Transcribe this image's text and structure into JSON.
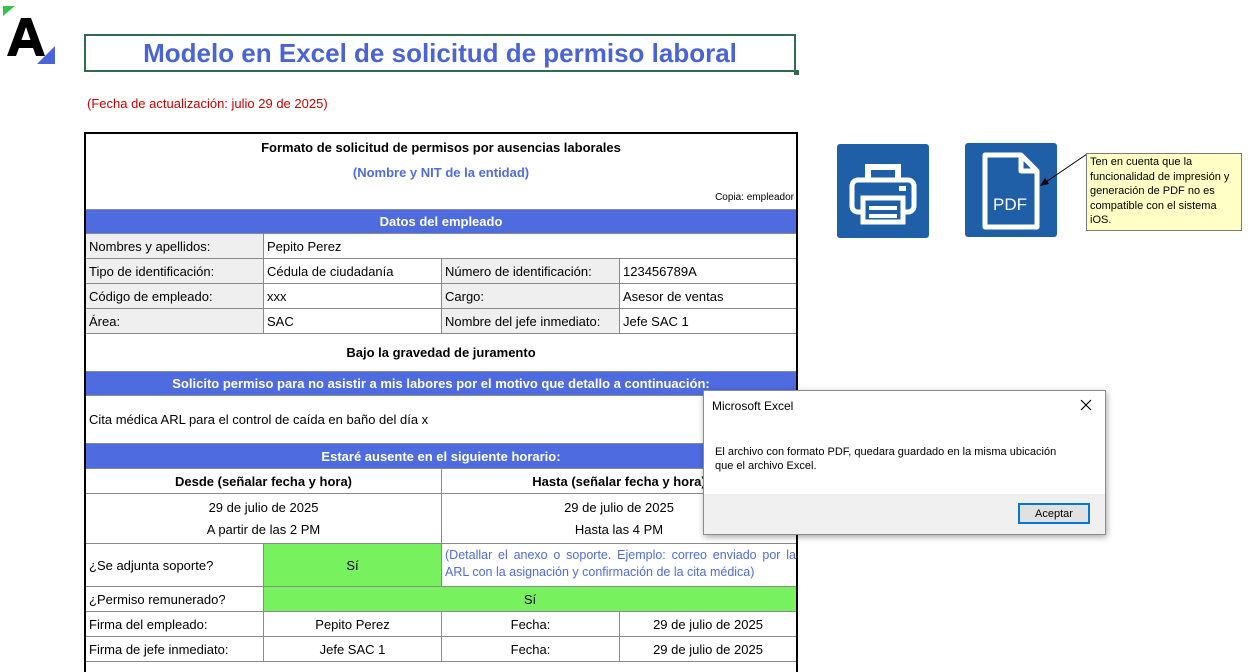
{
  "title": "Modelo en Excel de solicitud de permiso laboral",
  "update_note": "(Fecha de actualización: julio 29 de 2025)",
  "form": {
    "heading": "Formato de solicitud de permisos por ausencias laborales",
    "entity": "(Nombre y NIT de la entidad)",
    "copy": "Copia: empleador",
    "employee_band": "Datos del empleado",
    "name_label": "Nombres y apellidos:",
    "name_value": "Pepito Perez",
    "id_type_label": "Tipo de identificación:",
    "id_type_value": "Cédula de ciudadanía",
    "id_number_label": "Número de identificación:",
    "id_number_value": "123456789A",
    "code_label": "Código de empleado:",
    "code_value": "xxx",
    "position_label": "Cargo:",
    "position_value": "Asesor de ventas",
    "area_label": "Área:",
    "area_value": "SAC",
    "boss_label": "Nombre del jefe inmediato:",
    "boss_value": "Jefe SAC 1",
    "oath": "Bajo la gravedad de juramento",
    "reason_band": "Solicito permiso para no asistir a mis labores por el motivo que detallo a continuación:",
    "reason_text": "Cita médica ARL para el control de caída en baño del día x",
    "schedule_band": "Estaré ausente en el siguiente horario:",
    "from_header": "Desde (señalar fecha y hora)",
    "to_header": "Hasta (señalar fecha y hora)",
    "from_date": "29 de julio de 2025",
    "from_time": "A partir de las 2 PM",
    "to_date": "29 de julio de 2025",
    "to_time": "Hasta las 4 PM",
    "support_label": "¿Se adjunta soporte?",
    "support_value": "Sí",
    "support_note": "(Detallar el anexo o soporte. Ejemplo: correo enviado por la ARL con la asignación y confirmación de la cita médica)",
    "paid_label": "¿Permiso remunerado?",
    "paid_value": "Sí",
    "emp_sign_label": "Firma del empleado:",
    "emp_sign_value": "Pepito Perez",
    "date_label": "Fecha:",
    "emp_sign_date": "29 de julio de 2025",
    "boss_sign_label": "Firma de jefe inmediato:",
    "boss_sign_value": "Jefe SAC 1",
    "boss_sign_date": "29 de julio de 2025"
  },
  "icons": {
    "print": "printer-icon",
    "pdf": "pdf-icon",
    "pdf_text": "PDF"
  },
  "note": "Ten en cuenta que la funcionalidad de impresión y generación de PDF no es compatible con el sistema iOS.",
  "dialog": {
    "title": "Microsoft Excel",
    "message": "El archivo con formato PDF, quedara guardado en la misma ubicación que el archivo Excel.",
    "ok": "Aceptar"
  },
  "colors": {
    "band": "#4f6be0",
    "title": "#4a63d6",
    "green": "#77f25e",
    "icon_tile": "#1f5fa8",
    "note_bg": "#ffffc6",
    "update": "#cc0000"
  }
}
